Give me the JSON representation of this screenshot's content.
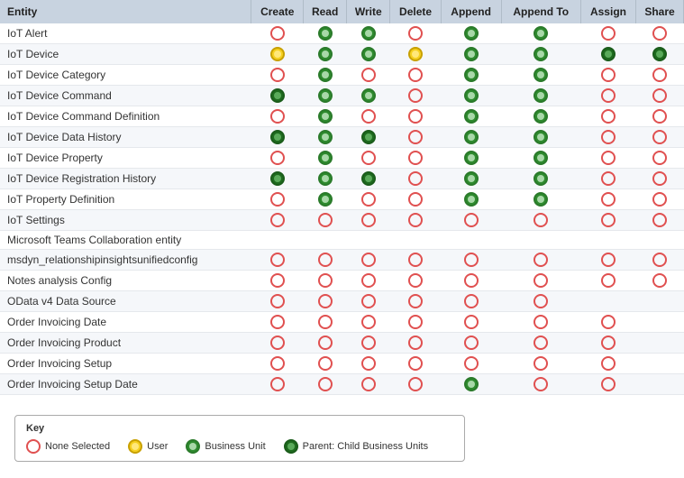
{
  "header": {
    "columns": [
      "Entity",
      "Create",
      "Read",
      "Write",
      "Delete",
      "Append",
      "Append To",
      "Assign",
      "Share"
    ]
  },
  "rows": [
    {
      "entity": "IoT Alert",
      "create": "empty",
      "read": "green",
      "write": "green",
      "delete": "empty",
      "append": "green",
      "appendTo": "green",
      "assign": "empty",
      "share": "empty"
    },
    {
      "entity": "IoT Device",
      "create": "yellow",
      "read": "green",
      "write": "green",
      "delete": "yellow",
      "append": "green",
      "appendTo": "green",
      "assign": "dark-green",
      "share": "dark-green"
    },
    {
      "entity": "IoT Device Category",
      "create": "empty",
      "read": "green",
      "write": "empty",
      "delete": "empty",
      "append": "green",
      "appendTo": "green",
      "assign": "empty",
      "share": "empty"
    },
    {
      "entity": "IoT Device Command",
      "create": "dark-green",
      "read": "green",
      "write": "green",
      "delete": "empty",
      "append": "green",
      "appendTo": "green",
      "assign": "empty",
      "share": "empty"
    },
    {
      "entity": "IoT Device Command Definition",
      "create": "empty",
      "read": "green",
      "write": "empty",
      "delete": "empty",
      "append": "green",
      "appendTo": "green",
      "assign": "empty",
      "share": "empty"
    },
    {
      "entity": "IoT Device Data History",
      "create": "dark-green",
      "read": "green",
      "write": "dark-green",
      "delete": "empty",
      "append": "green",
      "appendTo": "green",
      "assign": "empty",
      "share": "empty"
    },
    {
      "entity": "IoT Device Property",
      "create": "empty",
      "read": "green",
      "write": "empty",
      "delete": "empty",
      "append": "green",
      "appendTo": "green",
      "assign": "empty",
      "share": "empty"
    },
    {
      "entity": "IoT Device Registration History",
      "create": "dark-green",
      "read": "green",
      "write": "dark-green",
      "delete": "empty",
      "append": "green",
      "appendTo": "green",
      "assign": "empty",
      "share": "empty"
    },
    {
      "entity": "IoT Property Definition",
      "create": "empty",
      "read": "green",
      "write": "empty",
      "delete": "empty",
      "append": "green",
      "appendTo": "green",
      "assign": "empty",
      "share": "empty"
    },
    {
      "entity": "IoT Settings",
      "create": "empty",
      "read": "empty",
      "write": "empty",
      "delete": "empty",
      "append": "empty",
      "appendTo": "empty",
      "assign": "empty",
      "share": "empty"
    },
    {
      "entity": "Microsoft Teams Collaboration entity",
      "create": "",
      "read": "",
      "write": "",
      "delete": "",
      "append": "",
      "appendTo": "",
      "assign": "",
      "share": ""
    },
    {
      "entity": "msdyn_relationshipinsightsunifiedconfig",
      "create": "empty",
      "read": "empty",
      "write": "empty",
      "delete": "empty",
      "append": "empty",
      "appendTo": "empty",
      "assign": "empty",
      "share": "empty"
    },
    {
      "entity": "Notes analysis Config",
      "create": "empty",
      "read": "empty",
      "write": "empty",
      "delete": "empty",
      "append": "empty",
      "appendTo": "empty",
      "assign": "empty",
      "share": "empty"
    },
    {
      "entity": "OData v4 Data Source",
      "create": "empty",
      "read": "empty",
      "write": "empty",
      "delete": "empty",
      "append": "empty",
      "appendTo": "empty",
      "assign": "",
      "share": ""
    },
    {
      "entity": "Order Invoicing Date",
      "create": "empty",
      "read": "empty",
      "write": "empty",
      "delete": "empty",
      "append": "empty",
      "appendTo": "empty",
      "assign": "empty",
      "share": ""
    },
    {
      "entity": "Order Invoicing Product",
      "create": "empty",
      "read": "empty",
      "write": "empty",
      "delete": "empty",
      "append": "empty",
      "appendTo": "empty",
      "assign": "empty",
      "share": ""
    },
    {
      "entity": "Order Invoicing Setup",
      "create": "empty",
      "read": "empty",
      "write": "empty",
      "delete": "empty",
      "append": "empty",
      "appendTo": "empty",
      "assign": "empty",
      "share": ""
    },
    {
      "entity": "Order Invoicing Setup Date",
      "create": "empty",
      "read": "empty",
      "write": "empty",
      "delete": "empty",
      "append": "green",
      "appendTo": "empty",
      "assign": "empty",
      "share": ""
    }
  ],
  "key": {
    "title": "Key",
    "items": [
      {
        "type": "empty",
        "label": "None Selected"
      },
      {
        "type": "yellow",
        "label": "User"
      },
      {
        "type": "green",
        "label": "Business Unit"
      },
      {
        "type": "dark-green",
        "label": "Parent: Child Business Units"
      }
    ]
  }
}
